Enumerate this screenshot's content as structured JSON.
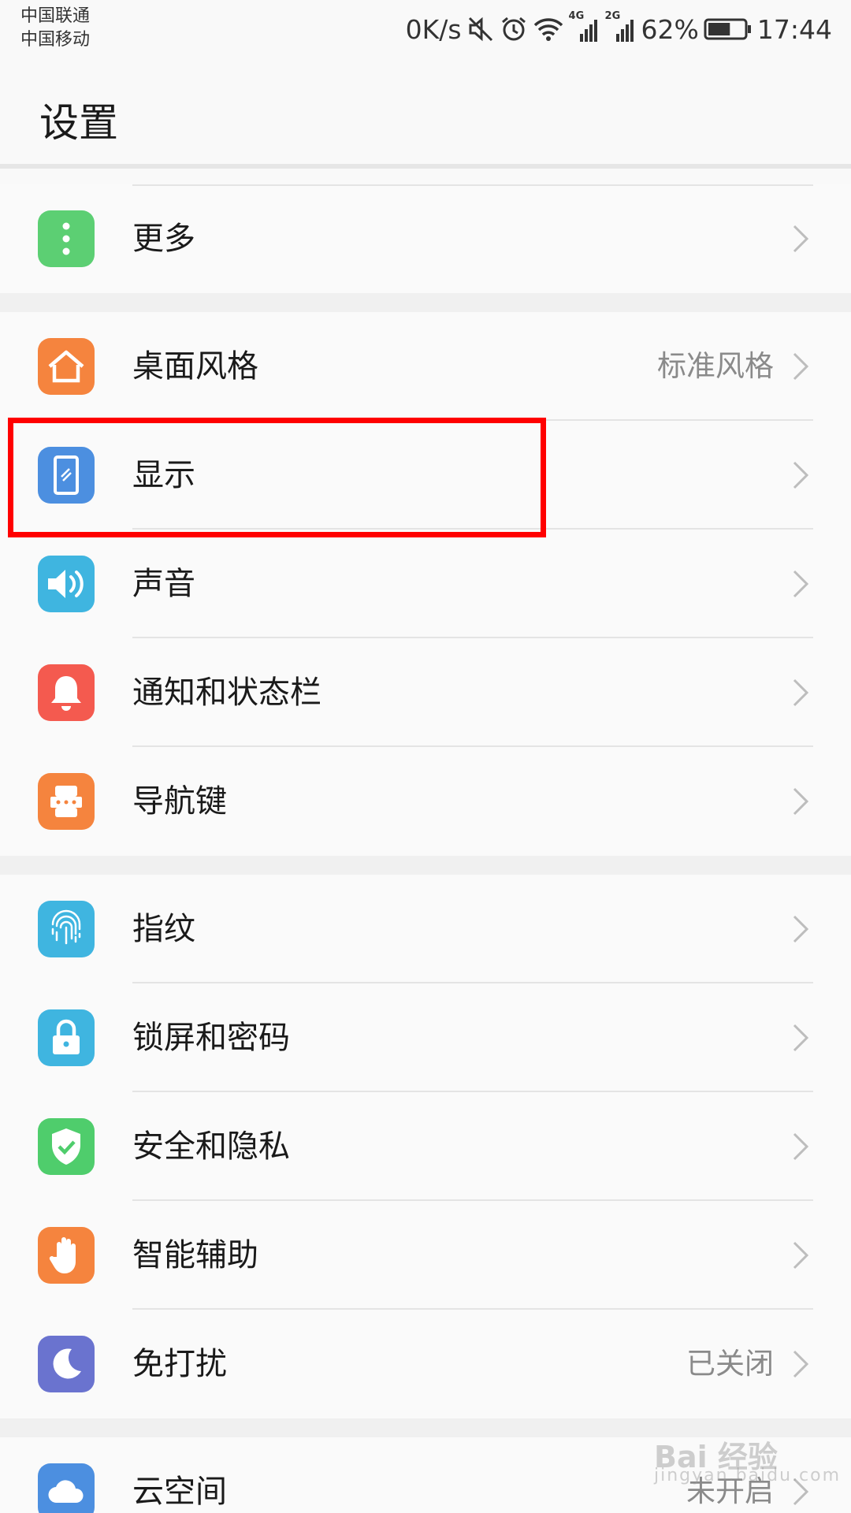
{
  "status_bar": {
    "carrier_1": "中国联通",
    "carrier_2": "中国移动",
    "net_speed": "0K/s",
    "net_4g": "4G",
    "net_2g": "2G",
    "battery_percent": "62%",
    "battery_level": 0.62,
    "time": "17:44",
    "icons": [
      "mute-icon",
      "alarm-icon",
      "wifi-icon",
      "signal-4g-icon",
      "signal-2g-icon",
      "battery-icon"
    ]
  },
  "header": {
    "title": "设置"
  },
  "sections": [
    {
      "items": [
        {
          "label": "更多",
          "value": "",
          "icon": "more-dots-icon",
          "color": "#5ccf73"
        }
      ]
    },
    {
      "items": [
        {
          "label": "桌面风格",
          "value": "标准风格",
          "icon": "home-icon",
          "color": "#f5843e"
        },
        {
          "label": "显示",
          "value": "",
          "icon": "display-icon",
          "color": "#4c8fe0"
        },
        {
          "label": "声音",
          "value": "",
          "icon": "speaker-icon",
          "color": "#3fb5e0"
        },
        {
          "label": "通知和状态栏",
          "value": "",
          "icon": "bell-icon",
          "color": "#f45a4f"
        },
        {
          "label": "导航键",
          "value": "",
          "icon": "navigation-key-icon",
          "color": "#f5843e"
        }
      ]
    },
    {
      "items": [
        {
          "label": "指纹",
          "value": "",
          "icon": "fingerprint-icon",
          "color": "#3fb5e0"
        },
        {
          "label": "锁屏和密码",
          "value": "",
          "icon": "lock-icon",
          "color": "#3fb5e0"
        },
        {
          "label": "安全和隐私",
          "value": "",
          "icon": "shield-check-icon",
          "color": "#4fcd6c"
        },
        {
          "label": "智能辅助",
          "value": "",
          "icon": "hand-icon",
          "color": "#f5843e"
        },
        {
          "label": "免打扰",
          "value": "已关闭",
          "icon": "moon-icon",
          "color": "#6a73cf"
        }
      ]
    },
    {
      "items": [
        {
          "label": "云空间",
          "value": "未开启",
          "icon": "cloud-icon",
          "color": "#4c8fe0"
        }
      ]
    }
  ],
  "watermark": {
    "text": "Bai 经验",
    "subtext": "jingyan.baidu.com"
  },
  "highlight_color": "#ff0000"
}
